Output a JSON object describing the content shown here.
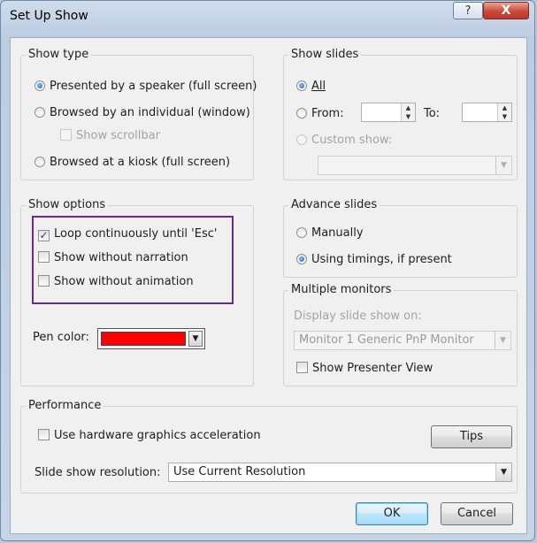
{
  "window": {
    "title": "Set Up Show",
    "help_glyph": "?",
    "close_glyph": "X"
  },
  "show_type": {
    "label": "Show type",
    "opt_speaker": "Presented by a speaker (full screen)",
    "opt_individual": "Browsed by an individual (window)",
    "show_scrollbar": "Show scrollbar",
    "opt_kiosk": "Browsed at a kiosk (full screen)"
  },
  "show_slides": {
    "label": "Show slides",
    "opt_all": "All",
    "opt_from": "From:",
    "to_label": "To:",
    "from_value": "",
    "to_value": "",
    "opt_custom": "Custom show:",
    "custom_value": ""
  },
  "show_options": {
    "label": "Show options",
    "loop": "Loop continuously until 'Esc'",
    "no_narration": "Show without narration",
    "no_animation": "Show without animation",
    "pen_label": "Pen color:",
    "pen_color": "#ff0000"
  },
  "advance_slides": {
    "label": "Advance slides",
    "opt_manual": "Manually",
    "opt_timings": "Using timings, if present"
  },
  "multiple_monitors": {
    "label": "Multiple monitors",
    "display_on": "Display slide show on:",
    "monitor_value": "Monitor 1 Generic PnP Monitor",
    "presenter_view": "Show Presenter View"
  },
  "performance": {
    "label": "Performance",
    "hw_accel": "Use hardware graphics acceleration",
    "tips": "Tips",
    "resolution_label": "Slide show resolution:",
    "resolution_value": "Use Current Resolution"
  },
  "buttons": {
    "ok": "OK",
    "cancel": "Cancel"
  },
  "colors": {
    "highlight_border": "#6a2b8c",
    "default_button_border": "#3c7fb1"
  }
}
